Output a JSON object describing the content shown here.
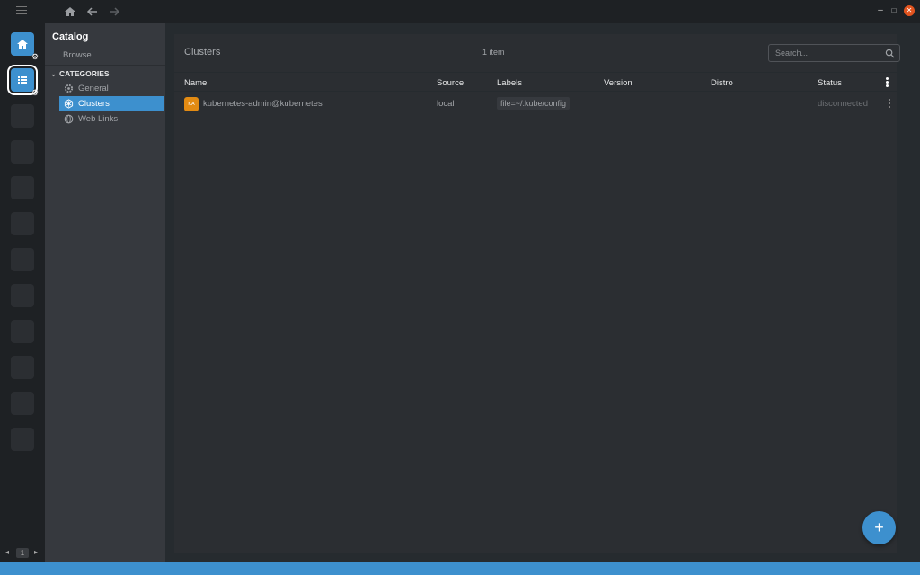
{
  "topbar": {
    "icons": [
      "menu-icon",
      "home-icon",
      "back-arrow-icon",
      "forward-arrow-icon"
    ],
    "window_controls": [
      "minimize",
      "maximize",
      "close"
    ]
  },
  "hotbar": {
    "page": "1",
    "empty_slots": 10
  },
  "sidebar": {
    "title": "Catalog",
    "browse": "Browse",
    "categories_label": "CATEGORIES",
    "items": [
      {
        "label": "General",
        "icon": "gear-icon",
        "active": false
      },
      {
        "label": "Clusters",
        "icon": "kubernetes-icon",
        "active": true
      },
      {
        "label": "Web Links",
        "icon": "globe-icon",
        "active": false
      }
    ]
  },
  "main": {
    "title": "Clusters",
    "item_count": "1 item",
    "search_placeholder": "Search...",
    "columns": [
      "Name",
      "Source",
      "Labels",
      "Version",
      "Distro",
      "Status"
    ],
    "rows": [
      {
        "avatar": "KA",
        "name": "kubernetes-admin@kubernetes",
        "source": "local",
        "labels": "file=~/.kube/config",
        "version": "",
        "distro": "",
        "status": "disconnected"
      }
    ],
    "fab": "+"
  },
  "colors": {
    "accent": "#3d90ce",
    "avatar": "#e38b13",
    "close": "#e2541f"
  }
}
